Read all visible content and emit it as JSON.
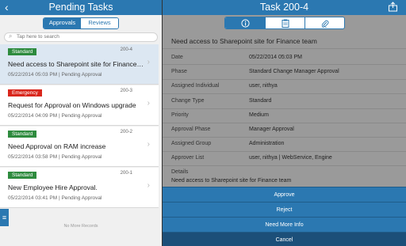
{
  "left": {
    "title": "Pending Tasks",
    "segments": [
      "Approvals",
      "Reviews"
    ],
    "search_placeholder": "Tap here to search",
    "tasks": [
      {
        "priority": "Standard",
        "id": "200-4",
        "title": "Need access to Sharepoint site for Finance team",
        "meta": "05/22/2014 05:03 PM | Pending Approval"
      },
      {
        "priority": "Emergency",
        "id": "200-3",
        "title": "Request for Approval on Windows upgrade",
        "meta": "05/22/2014 04:09 PM | Pending Approval"
      },
      {
        "priority": "Standard",
        "id": "200-2",
        "title": "Need Approval on RAM increase",
        "meta": "05/22/2014 03:58 PM | Pending Approval"
      },
      {
        "priority": "Standard",
        "id": "200-1",
        "title": "New Employee Hire Approval.",
        "meta": "05/22/2014 03:41 PM | Pending Approval"
      }
    ],
    "no_more": "No More Records"
  },
  "right": {
    "title": "Task 200-4",
    "summary": "Need access to Sharepoint site for Finance team",
    "fields": [
      {
        "label": "Date",
        "value": "05/22/2014 05:03 PM"
      },
      {
        "label": "Phase",
        "value": "Standard Change Manager Approval"
      },
      {
        "label": "Assigned Individual",
        "value": "user, nithya"
      },
      {
        "label": "Change Type",
        "value": "Standard"
      },
      {
        "label": "Priority",
        "value": "Medium"
      },
      {
        "label": "Approval Phase",
        "value": "Manager Approval"
      },
      {
        "label": "Assigned Group",
        "value": "Administration"
      },
      {
        "label": "Approver List",
        "value": "user, nithya | WebService, Engine"
      }
    ],
    "details_label": "Details",
    "details_value": "Need access to Sharepoint site for Finance team",
    "actions": [
      "Approve",
      "Reject",
      "Need More Info",
      "Cancel"
    ]
  },
  "colors": {
    "header": "#2b78b1",
    "standard": "#2e8b3e",
    "emergency": "#d9261c"
  },
  "icons": [
    "back-chevron-icon",
    "search-icon",
    "info-icon",
    "clipboard-icon",
    "paperclip-icon",
    "share-icon",
    "menu-icon"
  ]
}
